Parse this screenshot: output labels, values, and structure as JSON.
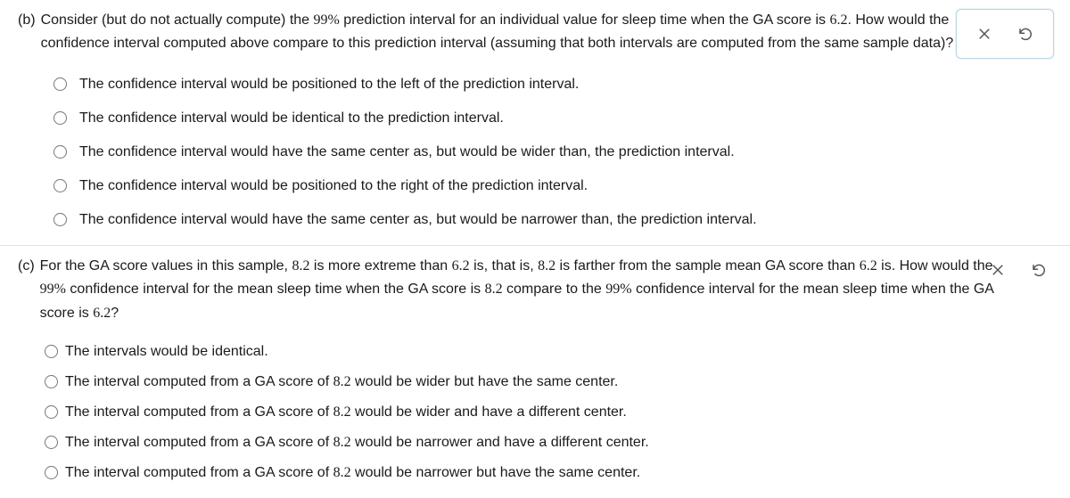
{
  "questions": [
    {
      "part": "(b)",
      "stem_segments": [
        {
          "t": "Consider (but do not actually compute) the "
        },
        {
          "t": "99%",
          "math": true
        },
        {
          "t": " prediction interval for an individual value for sleep time when the GA score is "
        },
        {
          "t": "6.2",
          "math": true
        },
        {
          "t": ". How would the confidence interval computed above compare to this prediction interval (assuming that both intervals are computed from the same sample data)?"
        }
      ],
      "actions_boxed": true,
      "options_class": "",
      "option_gap": "",
      "options": [
        [
          {
            "t": "The confidence interval would be positioned to the left of the prediction interval."
          }
        ],
        [
          {
            "t": "The confidence interval would be identical to the prediction interval."
          }
        ],
        [
          {
            "t": "The confidence interval would have the same center as, but would be wider than, the prediction interval."
          }
        ],
        [
          {
            "t": "The confidence interval would be positioned to the right of the prediction interval."
          }
        ],
        [
          {
            "t": "The confidence interval would have the same center as, but would be narrower than, the prediction interval."
          }
        ]
      ]
    },
    {
      "part": "(c)",
      "stem_segments": [
        {
          "t": "For the GA score values in this sample, "
        },
        {
          "t": "8.2",
          "math": true
        },
        {
          "t": " is more extreme than "
        },
        {
          "t": "6.2",
          "math": true
        },
        {
          "t": " is, that is, "
        },
        {
          "t": "8.2",
          "math": true
        },
        {
          "t": " is farther from the sample mean GA score than "
        },
        {
          "t": "6.2",
          "math": true
        },
        {
          "t": " is. How would the "
        },
        {
          "t": "99%",
          "math": true
        },
        {
          "t": " confidence interval for the mean sleep time when the GA score is "
        },
        {
          "t": "8.2",
          "math": true
        },
        {
          "t": " compare to the "
        },
        {
          "t": "99%",
          "math": true
        },
        {
          "t": " confidence interval for the mean sleep time when the GA score is "
        },
        {
          "t": "6.2",
          "math": true
        },
        {
          "t": "?"
        }
      ],
      "actions_boxed": false,
      "options_class": "tight",
      "option_gap": "small-gap",
      "options": [
        [
          {
            "t": "The intervals would be identical."
          }
        ],
        [
          {
            "t": "The interval computed from a GA score of "
          },
          {
            "t": "8.2",
            "math": true
          },
          {
            "t": " would be wider but have the same center."
          }
        ],
        [
          {
            "t": "The interval computed from a GA score of "
          },
          {
            "t": "8.2",
            "math": true
          },
          {
            "t": " would be wider and have a different center."
          }
        ],
        [
          {
            "t": "The interval computed from a GA score of "
          },
          {
            "t": "8.2",
            "math": true
          },
          {
            "t": " would be narrower and have a different center."
          }
        ],
        [
          {
            "t": "The interval computed from a GA score of "
          },
          {
            "t": "8.2",
            "math": true
          },
          {
            "t": " would be narrower but have the same center."
          }
        ]
      ]
    }
  ],
  "icons": {
    "close": "close-icon",
    "reset": "reset-icon"
  }
}
